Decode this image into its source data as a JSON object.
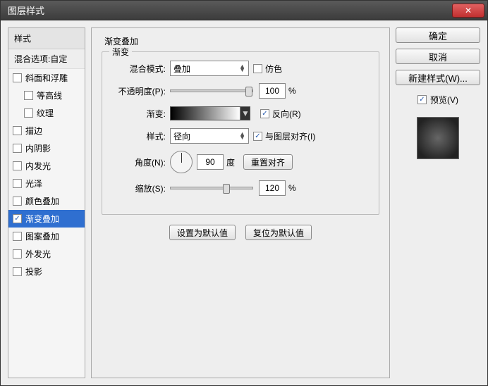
{
  "window": {
    "title": "图层样式"
  },
  "sidebar": {
    "header": "样式",
    "subheader": "混合选项:自定",
    "items": [
      {
        "label": "斜面和浮雕",
        "checked": false,
        "indent": false
      },
      {
        "label": "等高线",
        "checked": false,
        "indent": true
      },
      {
        "label": "纹理",
        "checked": false,
        "indent": true
      },
      {
        "label": "描边",
        "checked": false,
        "indent": false
      },
      {
        "label": "内阴影",
        "checked": false,
        "indent": false
      },
      {
        "label": "内发光",
        "checked": false,
        "indent": false
      },
      {
        "label": "光泽",
        "checked": false,
        "indent": false
      },
      {
        "label": "颜色叠加",
        "checked": false,
        "indent": false
      },
      {
        "label": "渐变叠加",
        "checked": true,
        "indent": false,
        "selected": true
      },
      {
        "label": "图案叠加",
        "checked": false,
        "indent": false
      },
      {
        "label": "外发光",
        "checked": false,
        "indent": false
      },
      {
        "label": "投影",
        "checked": false,
        "indent": false
      }
    ]
  },
  "main": {
    "section_title": "渐变叠加",
    "fieldset_legend": "渐变",
    "blend_mode": {
      "label": "混合模式:",
      "value": "叠加"
    },
    "dither": {
      "label": "仿色",
      "checked": false
    },
    "opacity": {
      "label": "不透明度(P):",
      "value": "100",
      "unit": "%"
    },
    "gradient": {
      "label": "渐变:"
    },
    "reverse": {
      "label": "反向(R)",
      "checked": true
    },
    "style": {
      "label": "样式:",
      "value": "径向"
    },
    "align": {
      "label": "与图层对齐(I)",
      "checked": true
    },
    "angle": {
      "label": "角度(N):",
      "value": "90",
      "unit": "度"
    },
    "reset_align": "重置对齐",
    "scale": {
      "label": "缩放(S):",
      "value": "120",
      "unit": "%"
    },
    "make_default": "设置为默认值",
    "reset_default": "复位为默认值"
  },
  "right": {
    "ok": "确定",
    "cancel": "取消",
    "new_style": "新建样式(W)...",
    "preview": {
      "label": "预览(V)",
      "checked": true
    }
  }
}
